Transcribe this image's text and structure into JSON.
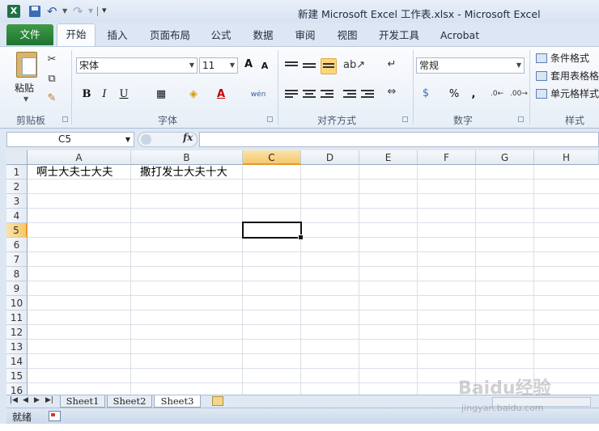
{
  "window": {
    "title": "新建 Microsoft Excel 工作表.xlsx  -  Microsoft Excel",
    "app_icon": "X"
  },
  "ribbon_tabs": [
    "文件",
    "开始",
    "插入",
    "页面布局",
    "公式",
    "数据",
    "审阅",
    "视图",
    "开发工具",
    "Acrobat"
  ],
  "ribbon": {
    "clipboard": {
      "paste_label": "粘贴",
      "group_label": "剪贴板"
    },
    "font": {
      "font_name": "宋体",
      "font_size": "11",
      "group_label": "字体",
      "bold": "B",
      "italic": "I",
      "underline": "U",
      "grow": "A",
      "shrink": "A",
      "phonetic": "wén"
    },
    "alignment": {
      "group_label": "对齐方式"
    },
    "number": {
      "format": "常规",
      "group_label": "数字",
      "percent": "%",
      "comma": ","
    },
    "styles": {
      "group_label": "样式",
      "items": [
        "条件格式",
        "套用表格格",
        "单元格样式"
      ]
    }
  },
  "formula_bar": {
    "name_box": "C5",
    "fx": "fx",
    "formula": ""
  },
  "grid": {
    "columns": [
      "A",
      "B",
      "C",
      "D",
      "E",
      "F",
      "G",
      "H"
    ],
    "rows": [
      "1",
      "2",
      "3",
      "4",
      "5",
      "6",
      "7",
      "8",
      "9",
      "10",
      "11",
      "12",
      "13",
      "14",
      "15",
      "16"
    ],
    "selected_cell": "C5",
    "cells": {
      "A1": "啊士大夫士大夫",
      "B1": "撒打发士大夫十大"
    }
  },
  "sheets": [
    "Sheet1",
    "Sheet2",
    "Sheet3"
  ],
  "active_sheet": "Sheet3",
  "status": {
    "text": "就绪"
  },
  "watermark": {
    "text": "Baidu经验",
    "sub": "jingyan.baidu.com"
  },
  "colors": {
    "accent_green": "#1e7431",
    "selection_orange": "#f5c86e"
  }
}
